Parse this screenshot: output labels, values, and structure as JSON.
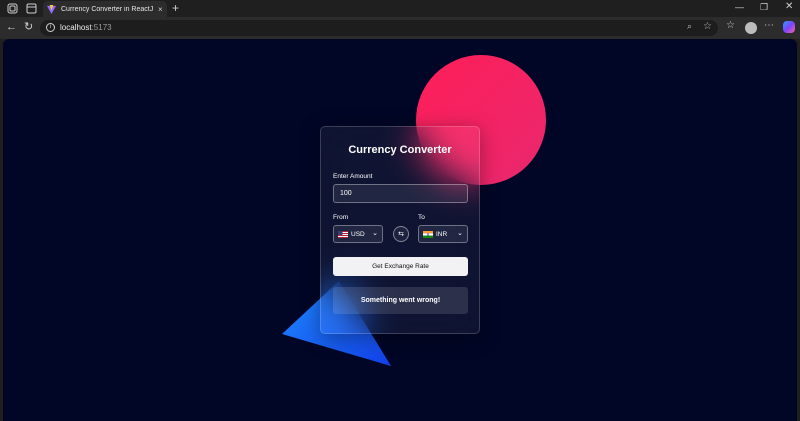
{
  "browser": {
    "tab_title": "Currency Converter in ReactJS | C",
    "tab_close": "×",
    "new_tab": "+",
    "url_host": "localhost",
    "url_port": ":5173",
    "window_min": "—",
    "window_max": "❐",
    "window_close": "✕"
  },
  "app": {
    "title": "Currency Converter",
    "amount_label": "Enter Amount",
    "amount_value": "100",
    "from_label": "From",
    "to_label": "To",
    "from_currency": "USD",
    "to_currency": "INR",
    "swap_glyph": "⇆",
    "chevron": "⌄",
    "button_label": "Get Exchange Rate",
    "result_text": "Something went wrong!"
  },
  "colors": {
    "page_bg": "#010626",
    "circle": "#ff1e58",
    "triangle": "#1a6bff",
    "button_bg": "#f2f2f4"
  }
}
